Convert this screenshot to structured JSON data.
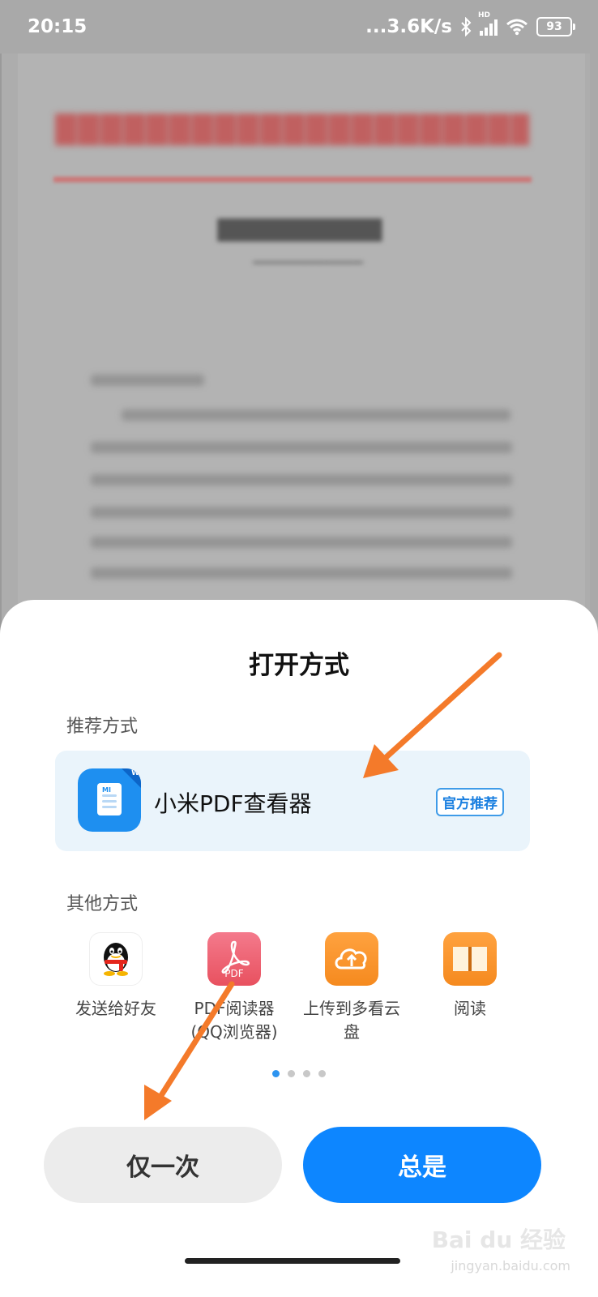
{
  "status_bar": {
    "time": "20:15",
    "network_speed": "...3.6K/s",
    "battery": "93",
    "hd_label": "HD",
    "icons": [
      "bluetooth-icon",
      "signal-icon",
      "wifi-icon",
      "battery-icon"
    ]
  },
  "sheet": {
    "title": "打开方式",
    "recommended_label": "推荐方式",
    "recommended_app": {
      "name": "小米PDF查看器",
      "badge": "官方推荐",
      "icon": "xiaomi-pdf-viewer-icon"
    },
    "other_label": "其他方式",
    "other_apps": [
      {
        "line1": "发送给好友",
        "line2": "",
        "icon": "qq-icon"
      },
      {
        "line1": "PDF阅读器",
        "line2": "(QQ浏览器)",
        "icon": "pdf-reader-icon",
        "icon_text": "PDF"
      },
      {
        "line1": "上传到多看云",
        "line2": "盘",
        "icon": "cloud-upload-icon"
      },
      {
        "line1": "阅读",
        "line2": "",
        "icon": "book-icon"
      }
    ],
    "page_dots": 4,
    "active_dot": 0,
    "buttons": {
      "once": "仅一次",
      "always": "总是"
    }
  },
  "watermark": {
    "brand": "Bai du 经验",
    "url": "jingyan.baidu.com"
  },
  "colors": {
    "accent": "#0d86ff",
    "annotation_arrow": "#f47a2a"
  }
}
